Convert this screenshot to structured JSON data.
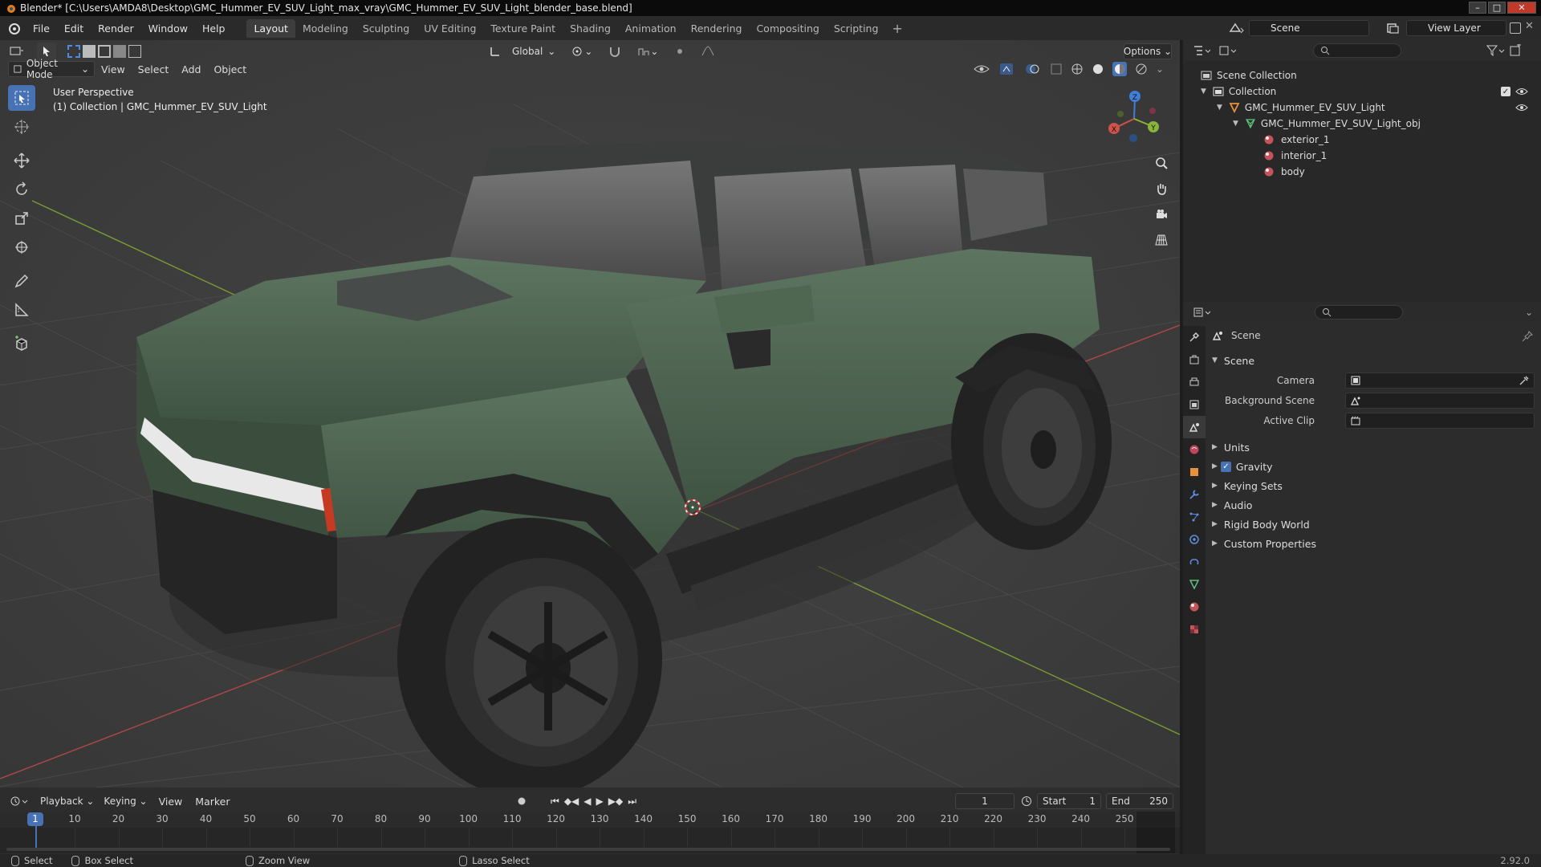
{
  "window": {
    "title": "Blender* [C:\\Users\\AMDA8\\Desktop\\GMC_Hummer_EV_SUV_Light_max_vray\\GMC_Hummer_EV_SUV_Light_blender_base.blend]",
    "minimize": "–",
    "maximize": "□",
    "close": "✕"
  },
  "menubar": {
    "menus": [
      "File",
      "Edit",
      "Render",
      "Window",
      "Help"
    ],
    "workspaces": [
      "Layout",
      "Modeling",
      "Sculpting",
      "UV Editing",
      "Texture Paint",
      "Shading",
      "Animation",
      "Rendering",
      "Compositing",
      "Scripting"
    ],
    "active_workspace": "Layout",
    "add_tab": "+",
    "scene": "Scene",
    "view_layer": "View Layer"
  },
  "viewport": {
    "orientation": "Global",
    "options": "Options",
    "mode": "Object Mode",
    "menus": [
      "View",
      "Select",
      "Add",
      "Object"
    ],
    "overlay_title": "User Perspective",
    "overlay_collection": "(1) Collection | GMC_Hummer_EV_SUV_Light",
    "gizmo": {
      "x": "X",
      "y": "Y",
      "z": "Z"
    }
  },
  "outliner": {
    "root": "Scene Collection",
    "collection": "Collection",
    "object": "GMC_Hummer_EV_SUV_Light",
    "mesh": "GMC_Hummer_EV_SUV_Light_obj",
    "materials": [
      "exterior_1",
      "interior_1",
      "body"
    ]
  },
  "properties": {
    "context": "Scene",
    "panel_title": "Scene",
    "fields": [
      {
        "label": "Camera"
      },
      {
        "label": "Background Scene"
      },
      {
        "label": "Active Clip"
      }
    ],
    "sections": [
      "Units",
      "Gravity",
      "Keying Sets",
      "Audio",
      "Rigid Body World",
      "Custom Properties"
    ],
    "gravity_checked": true
  },
  "timeline": {
    "menus": [
      "Playback",
      "Keying",
      "View",
      "Marker"
    ],
    "current_frame": "1",
    "start_label": "Start",
    "start": "1",
    "end_label": "End",
    "end": "250",
    "frames": [
      "1",
      "10",
      "20",
      "30",
      "40",
      "50",
      "60",
      "70",
      "80",
      "90",
      "100",
      "110",
      "120",
      "130",
      "140",
      "150",
      "160",
      "170",
      "180",
      "190",
      "200",
      "210",
      "220",
      "230",
      "240",
      "250"
    ]
  },
  "statusbar": {
    "select": "Select",
    "box_select": "Box Select",
    "zoom_view": "Zoom View",
    "lasso_select": "Lasso Select",
    "version": "2.92.0"
  },
  "colors": {
    "accent": "#4772b3",
    "body_paint": "#4f6650",
    "axis_x": "#d0504a",
    "axis_y": "#8bb43a",
    "axis_z": "#3f7fd9"
  }
}
